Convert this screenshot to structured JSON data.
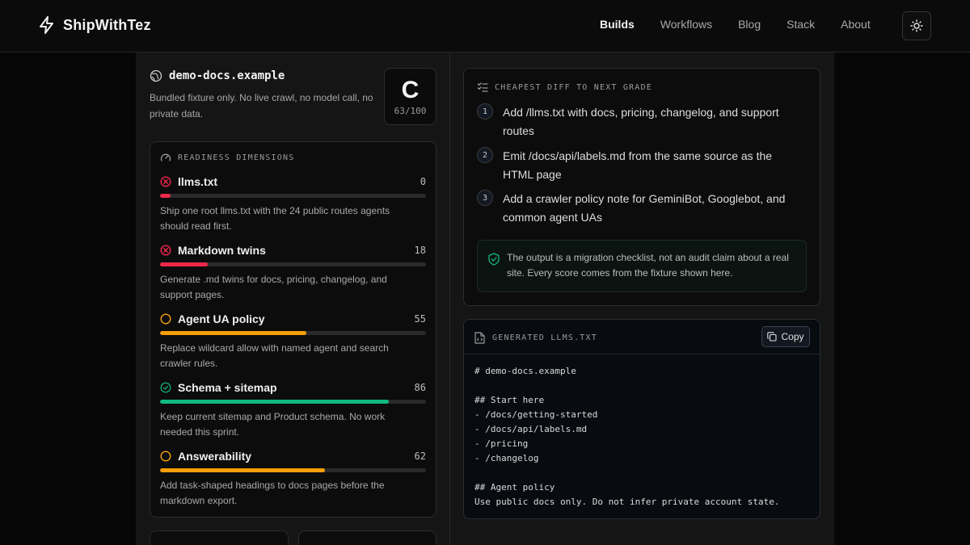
{
  "brand": {
    "name": "ShipWithTez",
    "icon": "lightning-icon"
  },
  "nav": {
    "links": [
      "Builds",
      "Workflows",
      "Blog",
      "Stack",
      "About"
    ],
    "active": "Builds",
    "theme_icon": "sun-icon"
  },
  "site": {
    "name": "demo-docs.example",
    "description": "Bundled fixture only. No live crawl, no model call, no private data.",
    "grade": "C",
    "score": "63/100"
  },
  "readiness": {
    "label": "READINESS DIMENSIONS",
    "dimensions": [
      {
        "name": "llms.txt",
        "score": 0,
        "status": "fail",
        "color": "#f0284a",
        "description": "Ship one root llms.txt with the 24 public routes agents should read first."
      },
      {
        "name": "Markdown twins",
        "score": 18,
        "status": "fail",
        "color": "#f0284a",
        "description": "Generate .md twins for docs, pricing, changelog, and support pages."
      },
      {
        "name": "Agent UA policy",
        "score": 55,
        "status": "warn",
        "color": "#f59e0b",
        "description": "Replace wildcard allow with named agent and search crawler rules."
      },
      {
        "name": "Schema + sitemap",
        "score": 86,
        "status": "pass",
        "color": "#10b981",
        "description": "Keep current sitemap and Product schema. No work needed this sprint."
      },
      {
        "name": "Answerability",
        "score": 62,
        "status": "warn",
        "color": "#f59e0b",
        "description": "Add task-shaped headings to docs pages before the markdown export."
      }
    ]
  },
  "diff": {
    "label": "CHEAPEST DIFF TO NEXT GRADE",
    "steps": [
      {
        "num": "1",
        "text": "Add /llms.txt with docs, pricing, changelog, and support routes"
      },
      {
        "num": "2",
        "text": "Emit /docs/api/labels.md from the same source as the HTML page"
      },
      {
        "num": "3",
        "text": "Add a crawler policy note for GeminiBot, Googlebot, and common agent UAs"
      }
    ],
    "note": "The output is a migration checklist, not an audit claim about a real site. Every score comes from the fixture shown here."
  },
  "generated": {
    "label": "GENERATED LLMS.TXT",
    "copy_label": "Copy",
    "code": "# demo-docs.example\n\n## Start here\n- /docs/getting-started\n- /docs/api/labels.md\n- /pricing\n- /changelog\n\n## Agent policy\nUse public docs only. Do not infer private account state."
  },
  "colors": {
    "fail": "#f0284a",
    "warn": "#f59e0b",
    "pass": "#10b981"
  }
}
